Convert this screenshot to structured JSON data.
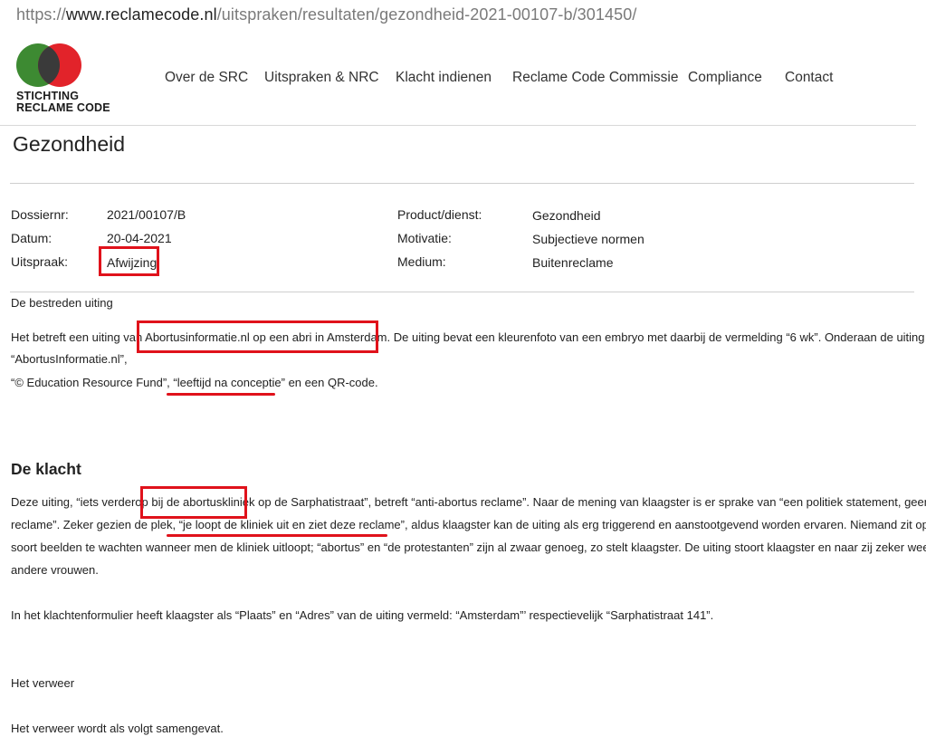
{
  "url": {
    "scheme": "https://",
    "host": "www.reclamecode.nl",
    "path": "/uitspraken/resultaten/gezondheid-2021-00107-b/301450/"
  },
  "logo": {
    "line1": "STICHTING",
    "line2": "RECLAME CODE",
    "colors": {
      "left_circle": "#3d8a32",
      "right_circle": "#e2232a",
      "overlap": "#3a3a3a"
    }
  },
  "nav": {
    "items": [
      "Over de SRC",
      "Uitspraken & NRC",
      "Klacht indienen",
      "Reclame Code Commissie",
      "Compliance",
      "Contact"
    ]
  },
  "page": {
    "title": "Gezondheid"
  },
  "meta": {
    "dossier_label": "Dossiernr:",
    "dossier_value": "2021/00107/B",
    "date_label": "Datum:",
    "date_value": "20-04-2021",
    "ruling_label": "Uitspraak:",
    "ruling_value": "Afwijzing",
    "product_label": "Product/dienst:",
    "product_value": "Gezondheid",
    "motivation_label": "Motivatie:",
    "motivation_value": "Subjectieve normen",
    "medium_label": "Medium:",
    "medium_value": "Buitenreclame"
  },
  "content": {
    "contested_heading": "De bestreden uiting",
    "p1_line1_a": "Het betreft een uiting van ",
    "p1_line1_highlight": "Abortusinformatie.nl op een abri in Amsterdam.",
    "p1_line1_b": " De uiting bevat een kleurenfoto van een embryo met daarbij de vermelding “6 wk”. Onderaan de uiting staat",
    "p1_line2": "“AbortusInformatie.nl”,",
    "p1_line3_a": "“© Education Resource Fund”, ",
    "p1_line3_underline": "“leeftijd na conceptie”",
    "p1_line3_b": " en een QR-code.",
    "complaint_heading": "De klacht",
    "c_line1_a": "Deze uiting, “iets verderop ",
    "c_line1_highlight": "bij de abortuskliniek",
    "c_line1_b": " op de Sarphatistraat”, betreft “anti-abortus reclame”. Naar de mening van klaagster is er sprake van “een politiek statement, geen",
    "c_line2_a": "reclame”. Zeker gezien de plek, ",
    "c_line2_underline": "“je loopt de kliniek uit en ziet deze reclame”",
    "c_line2_b": ", aldus klaagster kan de uiting als erg triggerend en aanstootgevend worden ervaren. Niemand zit op dit",
    "c_line3": "soort beelden te wachten wanneer men de kliniek uitloopt; “abortus” en “de protestanten” zijn al zwaar genoeg, zo stelt klaagster. De uiting stoort klaagster en naar zij zeker weet ook",
    "c_line4": "andere vrouwen.",
    "c_para2": "In het klachtenformulier heeft klaagster als “Plaats” en “Adres” van de uiting vermeld: “Amsterdam”’ respectievelijk “Sarphatistraat 141”.",
    "defence_heading": "Het verweer",
    "defence_para": "Het verweer wordt als volgt samengevat."
  },
  "annotations": {
    "color": "#e0121b"
  }
}
